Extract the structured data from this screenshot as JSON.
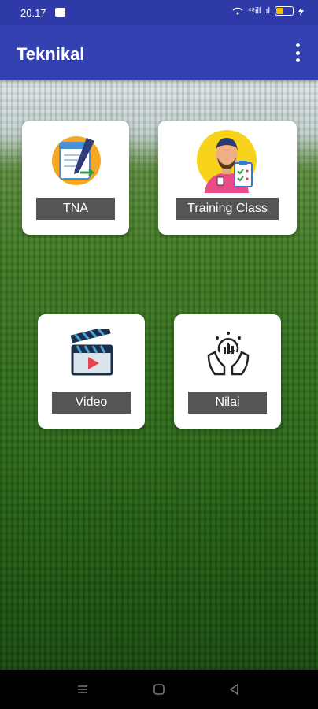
{
  "status": {
    "time": "20.17",
    "network": "⁴⁸ill .ıl"
  },
  "app": {
    "title": "Teknikal"
  },
  "menu": {
    "tna": "TNA",
    "training": "Training Class",
    "video": "Video",
    "nilai": "Nilai"
  },
  "icons": {
    "tna": "form-document-icon",
    "training": "trainer-clipboard-icon",
    "video": "clapperboard-icon",
    "nilai": "analytics-hand-icon",
    "more": "more-vert-icon"
  },
  "colors": {
    "app_bar": "#3340b0",
    "status_bar": "#2e3aa8",
    "label_bg": "#555555"
  }
}
